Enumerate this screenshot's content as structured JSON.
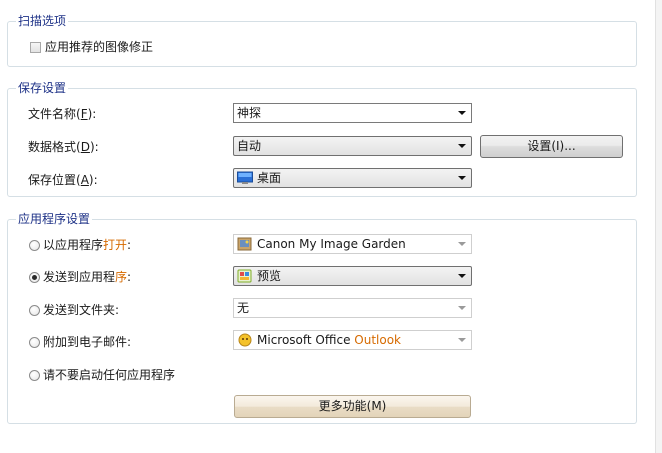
{
  "scan_options": {
    "title": "扫描选项",
    "apply_correction_label": "应用推荐的图像修正",
    "apply_correction_checked": false
  },
  "save_settings": {
    "title": "保存设置",
    "file_name": {
      "label": "文件名称(",
      "hotkey": "F",
      "suffix": "):",
      "value": "神探"
    },
    "data_format": {
      "label": "数据格式(",
      "hotkey": "D",
      "suffix": "):",
      "value": "自动",
      "settings_button": "设置(I)..."
    },
    "save_location": {
      "label": "保存位置(",
      "hotkey": "A",
      "suffix": "):",
      "value": "桌面",
      "icon": "desktop-icon"
    }
  },
  "app_settings": {
    "title": "应用程序设置",
    "open_with_app": {
      "label_prefix": "以应用程序",
      "label_hot": "打开",
      "label_suffix": ":",
      "value": "Canon My Image Garden",
      "selected": false,
      "icon": "image-garden-icon"
    },
    "send_to_app": {
      "label_prefix": "发送到应用程",
      "label_hot": "序",
      "label_suffix": ":",
      "value": "预览",
      "selected": true,
      "icon": "preview-app-icon"
    },
    "send_to_folder": {
      "label": "发送到文件夹:",
      "value": "无",
      "selected": false
    },
    "attach_email": {
      "label": "附加到电子邮件:",
      "value_plain": "Microsoft Office ",
      "value_hot": "Outlook",
      "selected": false,
      "icon": "outlook-icon"
    },
    "no_app": {
      "label": "请不要启动任何应用程序",
      "selected": false
    },
    "more_button": "更多功能(M)"
  },
  "colors": {
    "group_title": "#1e3287",
    "accent_orange": "#d66a00",
    "group_border": "#d5dfe5"
  }
}
